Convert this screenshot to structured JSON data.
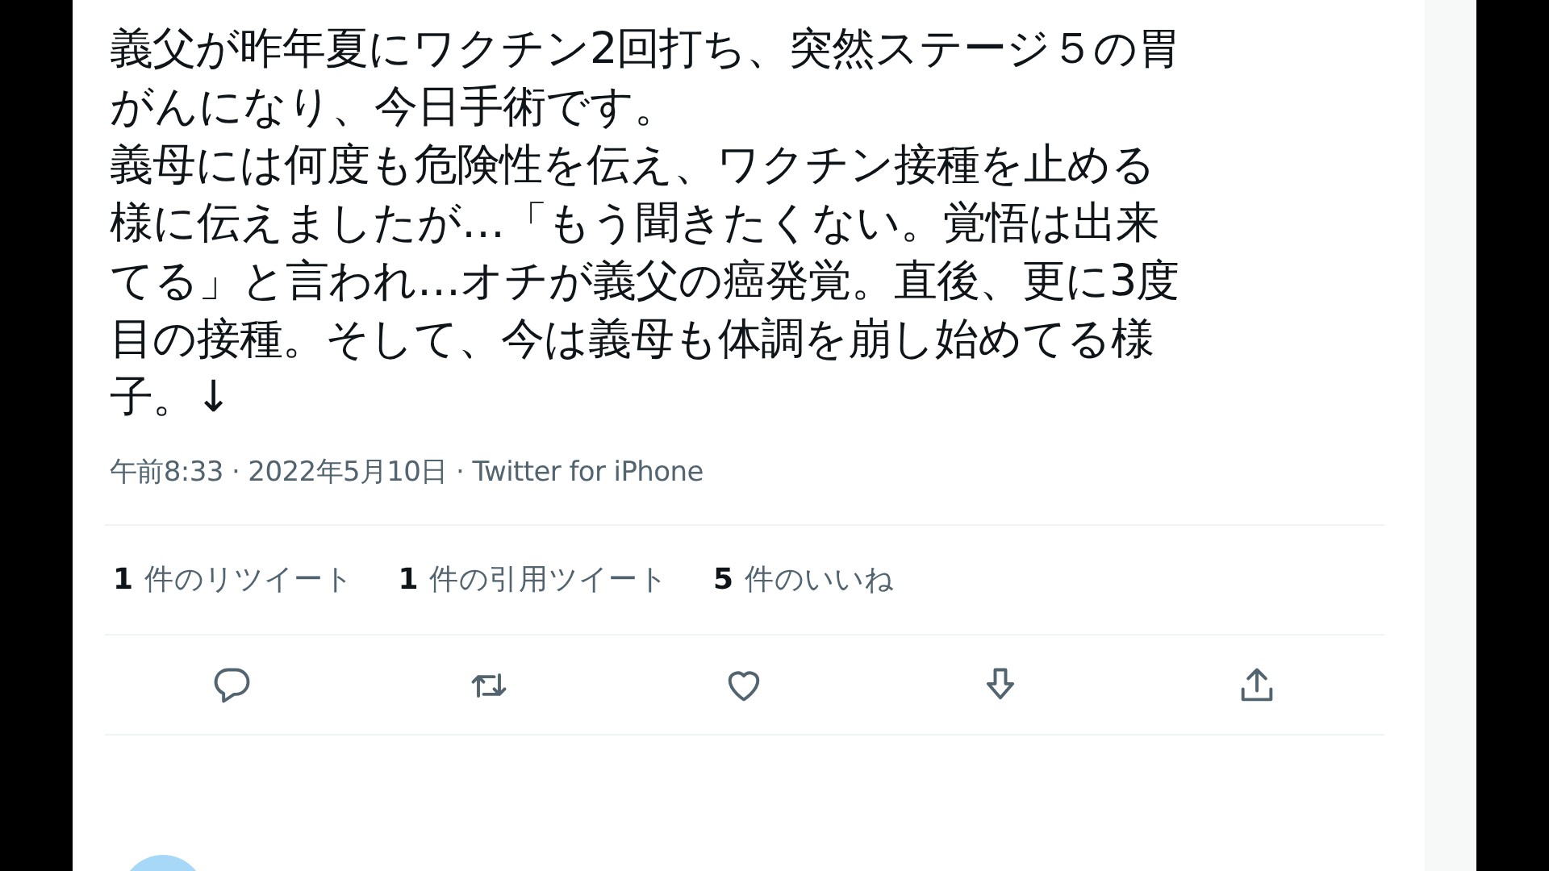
{
  "tweet": {
    "text_lines": [
      "義父が昨年夏にワクチン2回打ち、突然ステージ５の胃",
      "がんになり、今日手術です。",
      "義母には何度も危険性を伝え、ワクチン接種を止める",
      "様に伝えましたが…「もう聞きたくない。覚悟は出来",
      "てる」と言われ…オチが義父の癌発覚。直後、更に3度",
      "目の接種。そして、今は義母も体調を崩し始めてる様",
      "子。↓"
    ],
    "meta": "午前8:33 · 2022年5月10日 · Twitter for iPhone",
    "stats": [
      {
        "label": "**1** 件のリツイート"
      },
      {
        "label": "**1** 件の引用ツイート"
      },
      {
        "label": "**5** 件のいいね"
      }
    ],
    "actions": [
      {
        "kind": "reply"
      },
      {
        "kind": "retweet"
      },
      {
        "kind": "like"
      },
      {
        "kind": "save"
      },
      {
        "kind": "share"
      }
    ]
  }
}
